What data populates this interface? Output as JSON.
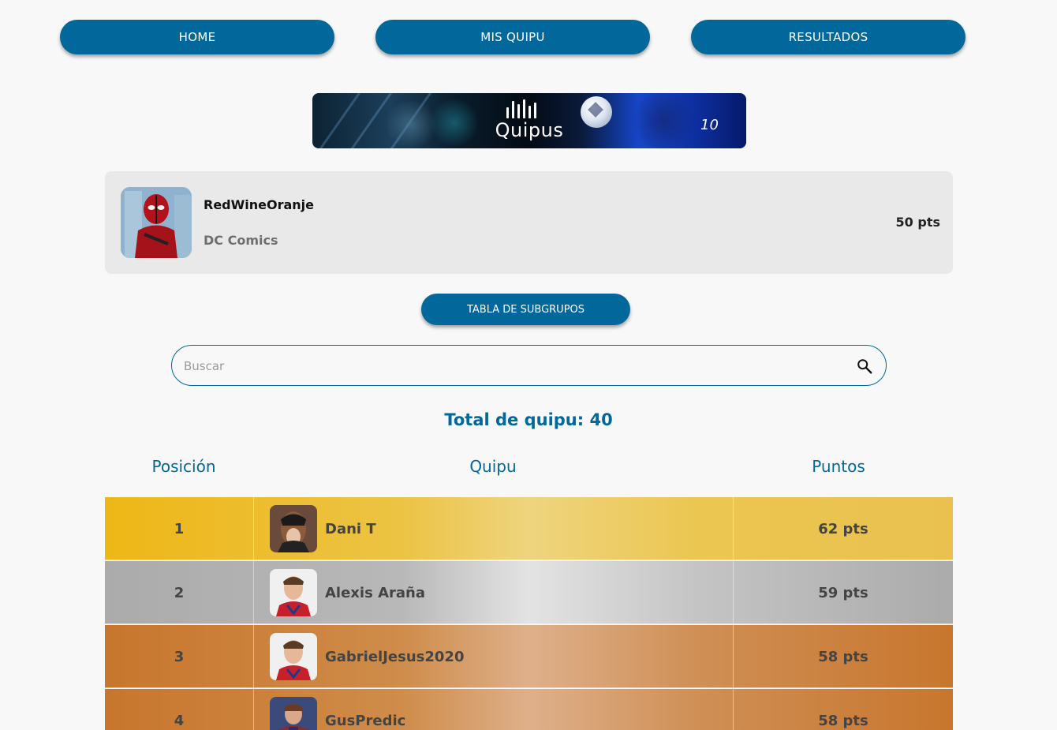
{
  "nav": {
    "home": "HOME",
    "mis_quipu": "MIS QUIPU",
    "resultados": "RESULTADOS"
  },
  "banner": {
    "logo_text": "Quipus",
    "jersey_number": "10"
  },
  "user": {
    "name": "RedWineOranje",
    "group": "DC Comics",
    "points": "50 pts"
  },
  "subgroups_button": "TABLA DE SUBGRUPOS",
  "search": {
    "placeholder": "Buscar",
    "icon": "search-icon"
  },
  "total": "Total de quipu: 40",
  "table": {
    "headers": {
      "position": "Posición",
      "quipu": "Quipu",
      "points": "Puntos"
    },
    "rows": [
      {
        "position": "1",
        "name": "Dani T",
        "points": "62 pts",
        "tier": "gold"
      },
      {
        "position": "2",
        "name": "Alexis Araña",
        "points": "59 pts",
        "tier": "silver"
      },
      {
        "position": "3",
        "name": "GabrielJesus2020",
        "points": "58 pts",
        "tier": "bronze"
      },
      {
        "position": "4",
        "name": "GusPredic",
        "points": "58 pts",
        "tier": "bronze"
      }
    ]
  },
  "colors": {
    "primary": "#02679a",
    "gold": "#eeb717",
    "silver": "#ababab",
    "bronze": "#c8762d"
  }
}
